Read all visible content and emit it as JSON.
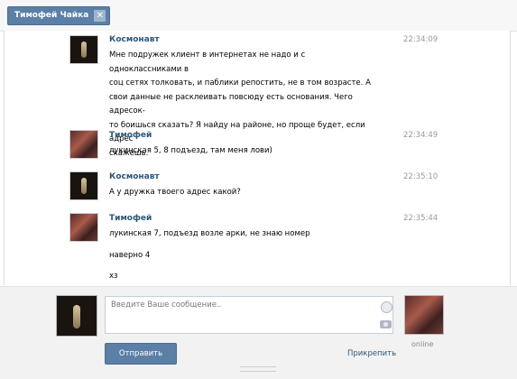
{
  "tab": {
    "title": "Тимофей Чайка",
    "close": "✕"
  },
  "messages": [
    {
      "author": "Космонавт",
      "time": "22:34:09",
      "lines": [
        "Мне подружек клиент в интернетах не надо и с одноклассниками в",
        "соц сетях толковать, и паблики репостить, не в том возрасте. А",
        "свои данные не расклеивать повсюду есть основания. Чего адресок-",
        "то боишься сказать? Я найду на районе, но проще будет, если адрес",
        "скажешь."
      ]
    },
    {
      "author": "Тимофей",
      "time": "22:34:49",
      "lines": [
        "лукинская 5, 8 подъезд, там меня лови)"
      ]
    },
    {
      "author": "Космонавт",
      "time": "22:35:10",
      "lines": [
        "А у дружка твоего адрес какой?"
      ]
    },
    {
      "author": "Тимофей",
      "time": "22:35:44",
      "lines": [
        "лукинская 7, подъезд возле арки, не знаю номер",
        "",
        "наверно 4",
        "",
        "хз"
      ]
    }
  ],
  "composer": {
    "placeholder": "Введите Ваше сообщение..",
    "send_label": "Отправить",
    "attach_label": "Прикрепить",
    "status": "online"
  }
}
